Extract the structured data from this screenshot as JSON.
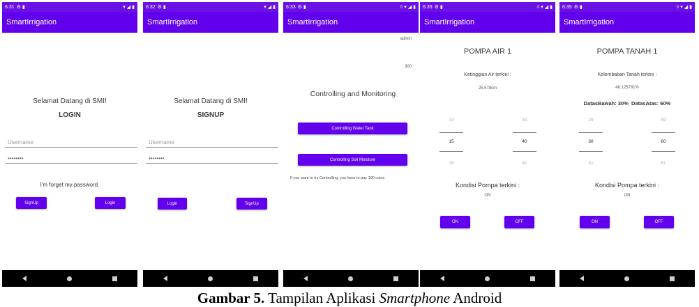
{
  "screens": [
    {
      "status_time": "6:31",
      "app_title": "SmartIrrigation",
      "welcome": "Selamat Datang di SMI!",
      "heading": "LOGIN",
      "username_placeholder": "Username",
      "password_value": "••••••••",
      "forgot_text": "I'm forget my password.",
      "left_button": "SignUp",
      "right_button": "Login"
    },
    {
      "status_time": "6:32",
      "app_title": "SmartIrrigation",
      "welcome": "Selamat Datang di SMI!",
      "heading": "SIGNUP",
      "username_placeholder": "Username",
      "password_value": "••••••••",
      "left_button": "Login",
      "right_button": "SignUp"
    },
    {
      "status_time": "6:33",
      "app_title": "SmartIrrigation",
      "user": "admin",
      "coins": "300",
      "heading": "Controlling and Monitoring",
      "button_water": "Controlling Water Tank",
      "button_soil": "Controlling Soil Moisture",
      "note": "If you want to try Controlling, you have to pay 100 coins"
    },
    {
      "status_time": "6:35",
      "app_title": "SmartIrrigation",
      "heading": "POMPA AIR 1",
      "reading_label": "Ketinggian Air terkini :",
      "reading_value": "25.578cm",
      "picker_left": [
        "14",
        "15",
        "16"
      ],
      "picker_right": [
        "39",
        "40",
        "41"
      ],
      "condition_label": "Kondisi Pompa terkini :",
      "condition_value": "ON",
      "button_on": "ON",
      "button_off": "OFF"
    },
    {
      "status_time": "6:35",
      "app_title": "SmartIrrigation",
      "heading": "POMPA TANAH 1",
      "reading_label": "Kelembaban Tanah terkini :",
      "reading_value": "48.125781%",
      "limits_text": "DatasBawah: 30%  DatasAtas: 60%",
      "picker_left": [
        "29",
        "30",
        "31"
      ],
      "picker_right": [
        "59",
        "60",
        "61"
      ],
      "condition_label": "Kondisi Pompa terkini :",
      "condition_value": "ON",
      "button_on": "ON",
      "button_off": "OFF"
    }
  ],
  "caption": {
    "bold": "Gambar 5.",
    "text1": " Tampilan Aplikasi ",
    "italic": "Smartphone",
    "text2": " Android"
  },
  "colors": {
    "app_bar": "#6200ee",
    "status_bar": "#6a11e6",
    "nav_bar": "#000000"
  }
}
